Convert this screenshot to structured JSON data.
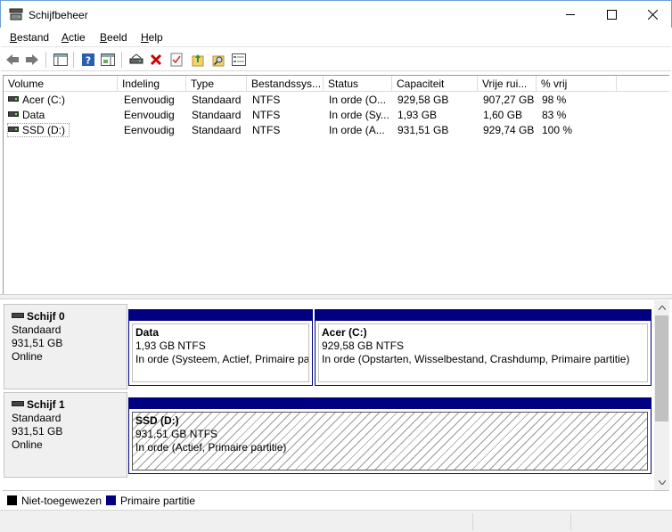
{
  "window": {
    "title": "Schijfbeheer",
    "minimize_glyph": "—",
    "maximize_glyph": "☐",
    "close_glyph": "✕"
  },
  "menu": [
    {
      "label": "Bestand",
      "accel": "B",
      "rest": "estand"
    },
    {
      "label": "Actie",
      "accel": "A",
      "rest": "ctie"
    },
    {
      "label": "Beeld",
      "accel": "B",
      "rest": "eeld"
    },
    {
      "label": "Help",
      "accel": "H",
      "rest": "elp"
    }
  ],
  "toolbar": {
    "icons": [
      "back-arrow-icon",
      "forward-arrow-icon",
      "console-tree-icon",
      "help-icon",
      "details-pane-icon",
      "connect-drive-icon",
      "delete-icon",
      "properties-check-icon",
      "open-folder-icon",
      "search-folder-icon",
      "settings-list-icon"
    ]
  },
  "volumes": {
    "columns": [
      "Volume",
      "Indeling",
      "Type",
      "Bestandssys...",
      "Status",
      "Capaciteit",
      "Vrije rui...",
      "% vrij"
    ],
    "rows": [
      [
        "Acer (C:)",
        "Eenvoudig",
        "Standaard",
        "NTFS",
        "In orde (O...",
        "929,58 GB",
        "907,27 GB",
        "98 %"
      ],
      [
        "Data",
        "Eenvoudig",
        "Standaard",
        "NTFS",
        "In orde (Sy...",
        "1,93 GB",
        "1,60 GB",
        "83 %"
      ],
      [
        "SSD (D:)",
        "Eenvoudig",
        "Standaard",
        "NTFS",
        "In orde (A...",
        "931,51 GB",
        "929,74 GB",
        "100 %"
      ]
    ]
  },
  "disks": [
    {
      "name": "Schijf 0",
      "type": "Standaard",
      "size": "931,51 GB",
      "state": "Online",
      "partitions": [
        {
          "name": "Data",
          "size": "1,93 GB NTFS",
          "status": "In orde (Systeem, Actief, Primaire par"
        },
        {
          "name": "Acer  (C:)",
          "size": "929,58 GB NTFS",
          "status": "In orde (Opstarten, Wisselbestand, Crashdump, Primaire partitie)"
        }
      ]
    },
    {
      "name": "Schijf 1",
      "type": "Standaard",
      "size": "931,51 GB",
      "state": "Online",
      "partitions": [
        {
          "name": "SSD  (D:)",
          "size": "931,51 GB NTFS",
          "status": "In orde (Actief, Primaire partitie)"
        }
      ]
    }
  ],
  "legend": [
    {
      "label": "Niet-toegewezen",
      "color": "#000000"
    },
    {
      "label": "Primaire partitie",
      "color": "#000080"
    }
  ],
  "colors": {
    "partition_bar": "#000080",
    "unallocated": "#000000"
  }
}
